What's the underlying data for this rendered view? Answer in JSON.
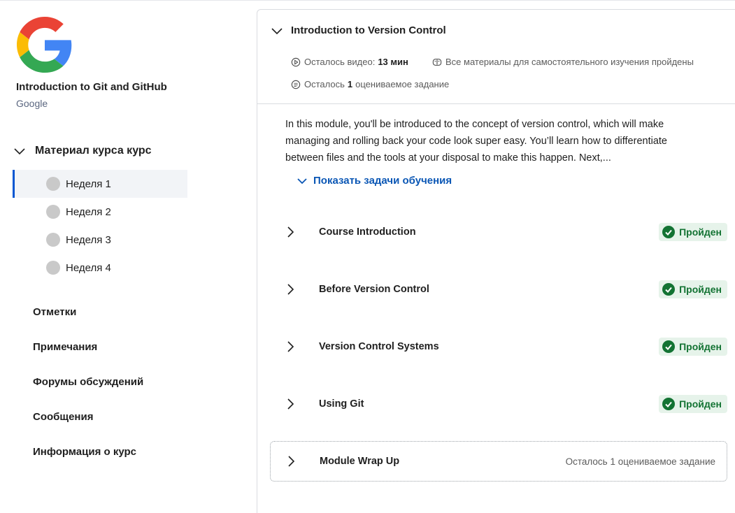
{
  "course": {
    "title": "Introduction to Git and GitHub",
    "partner": "Google"
  },
  "sidebar": {
    "section_label": "Материал курса курс",
    "weeks": [
      {
        "label": "Неделя 1",
        "active": true
      },
      {
        "label": "Неделя 2",
        "active": false
      },
      {
        "label": "Неделя 3",
        "active": false
      },
      {
        "label": "Неделя 4",
        "active": false
      }
    ],
    "links": [
      "Отметки",
      "Примечания",
      "Форумы обсуждений",
      "Сообщения",
      "Информация о курс"
    ]
  },
  "module": {
    "title": "Introduction to Version Control",
    "video_left_label": "Осталось видео:",
    "video_left_value": "13 мин",
    "self_study": "Все материалы для самостоятельного изучения пройдены",
    "graded_prefix": "Осталось",
    "graded_count": "1",
    "graded_suffix": "оцениваемое задание",
    "description": "In this module, you'll be introduced to the concept of version control, which will make managing and rolling back your code look super easy. You’ll learn how to differentiate between files and the tools at your disposal to make this happen. Next,...",
    "show_objectives": "Показать задачи обучения",
    "items": [
      {
        "title": "Course Introduction",
        "status": "Пройден"
      },
      {
        "title": "Before Version Control",
        "status": "Пройден"
      },
      {
        "title": "Version Control Systems",
        "status": "Пройден"
      },
      {
        "title": "Using Git",
        "status": "Пройден"
      }
    ],
    "wrap_up": {
      "title": "Module Wrap Up",
      "note": "Осталось 1 оцениваемое задание"
    }
  },
  "colors": {
    "accent": "#0056d2",
    "link": "#0b57b5",
    "success_bg": "#e6f3ea",
    "success_text": "#137333"
  }
}
